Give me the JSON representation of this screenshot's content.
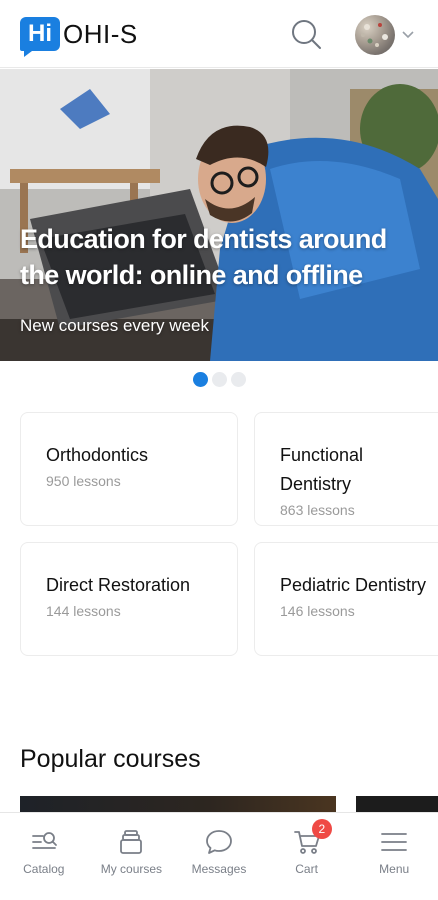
{
  "header": {
    "logo_badge": "Hi",
    "logo_text": "OHI-S",
    "search_icon": "search-icon",
    "avatar_icon": "avatar",
    "chevron_icon": "chevron-down-icon"
  },
  "hero": {
    "title": "Education for dentists around the world: online and offline",
    "subtitle": "New courses every week",
    "slides_total": 3,
    "active_slide": 1
  },
  "categories": [
    {
      "title": "Orthodontics",
      "lessons": "950 lessons"
    },
    {
      "title": "Functional Dentistry",
      "lessons": "863 lessons"
    },
    {
      "title": "Direct Restoration",
      "lessons": "144 lessons"
    },
    {
      "title": "Pediatric Dentistry",
      "lessons": "146 lessons"
    }
  ],
  "popular": {
    "title": "Popular courses"
  },
  "bottom_nav": [
    {
      "label": "Catalog",
      "icon": "catalog-icon"
    },
    {
      "label": "My courses",
      "icon": "my-courses-icon"
    },
    {
      "label": "Messages",
      "icon": "messages-icon"
    },
    {
      "label": "Cart",
      "icon": "cart-icon",
      "badge": "2"
    },
    {
      "label": "Menu",
      "icon": "menu-icon"
    }
  ],
  "colors": {
    "accent": "#1a7fe0",
    "badge": "#ef4a45",
    "muted_text": "#9a9a9a"
  }
}
